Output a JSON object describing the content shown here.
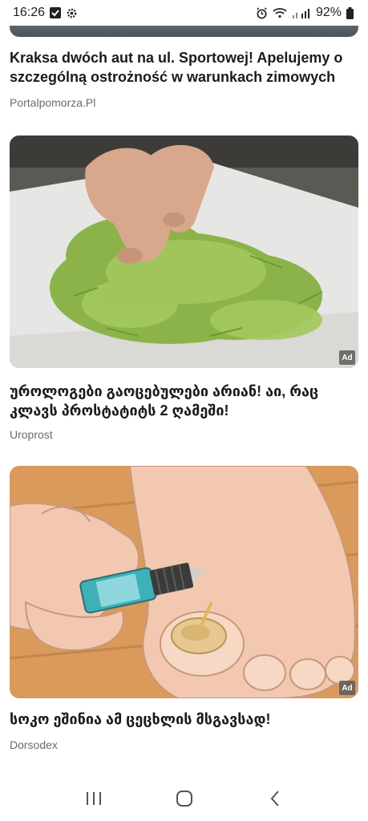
{
  "status_bar": {
    "time": "16:26",
    "battery": "92%",
    "icons_left": [
      "checkbox-icon",
      "gear-icon"
    ],
    "icons_right": [
      "alarm-icon",
      "wifi-icon",
      "signal-icon",
      "battery-icon"
    ]
  },
  "articles": [
    {
      "headline": "Kraksa dwóch aut na ul. Sportowej! Apelujemy o szczególną ostrożność w warunkach zimowych",
      "source": "Portalpomorza.Pl"
    },
    {
      "headline": "უროლოგები გაოცებულები არიან! აი, რაც კლავს პროსტატიტს 2 ღამეში!",
      "source": "Uroprost",
      "ad_label": "Ad",
      "image": "hands-herbs-image"
    },
    {
      "headline": "სოკო ეშინია ამ ცეცხლის მსგავსად!",
      "source": "Dorsodex",
      "ad_label": "Ad",
      "image": "foot-oil-image"
    }
  ],
  "nav_bar": {
    "buttons": [
      "recent-apps-icon",
      "home-icon",
      "back-icon"
    ]
  }
}
